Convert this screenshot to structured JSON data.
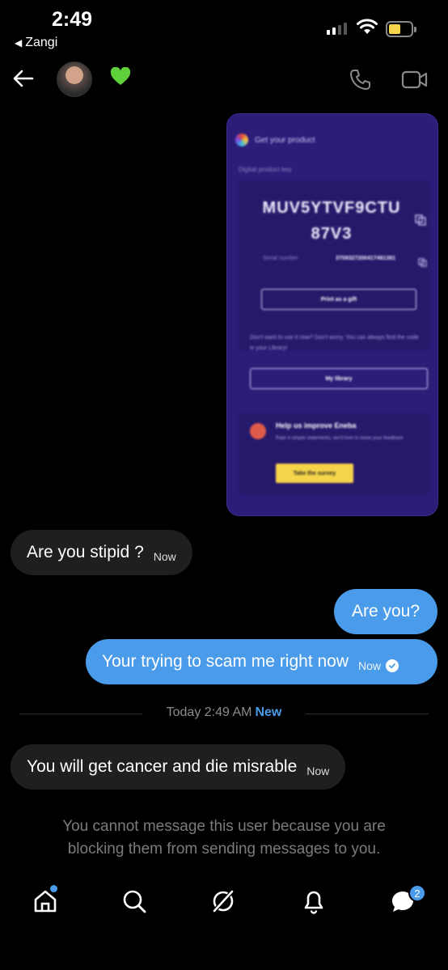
{
  "status_bar": {
    "time": "2:49",
    "back_app": "Zangi"
  },
  "header": {
    "contact_emoji": "💚",
    "icons": [
      "back-arrow-icon",
      "phone-icon",
      "video-icon"
    ]
  },
  "attachment": {
    "header_title": "Get your product",
    "subtitle": "Digital product key",
    "product_key": "MUV5YTVF9CTU 87V3",
    "serial_label": "Serial number",
    "serial_value": "3709327200417491381",
    "print_button": "Print as a gift",
    "note": "Don't want to use it now? Don't worry. You can always find the code in your Library!",
    "library_button": "My library",
    "survey_title": "Help us improve Eneba",
    "survey_sub": "Rate 4 simple statements, we'd love to know your feedback",
    "survey_button": "Take the survey"
  },
  "messages": [
    {
      "direction": "in",
      "text": "Are you stipid ?",
      "time": "Now"
    },
    {
      "direction": "out",
      "text": "Are you?",
      "time": ""
    },
    {
      "direction": "out",
      "text": "Your trying to scam me right now",
      "time": "Now",
      "read": true
    },
    {
      "direction": "in",
      "text": "You will get cancer and die misrable",
      "time": "Now"
    }
  ],
  "divider": {
    "text": "Today 2:49 AM",
    "new_label": "New"
  },
  "blocked_notice": "You cannot message this user because you are blocking them from sending messages to you.",
  "bottom_nav": {
    "items": [
      "home-icon",
      "search-icon",
      "grok-icon",
      "notifications-icon",
      "messages-icon"
    ],
    "messages_badge": "2"
  },
  "colors": {
    "accent": "#4a9be9",
    "incoming_bubble": "#1f1f1f",
    "background": "#000000"
  }
}
